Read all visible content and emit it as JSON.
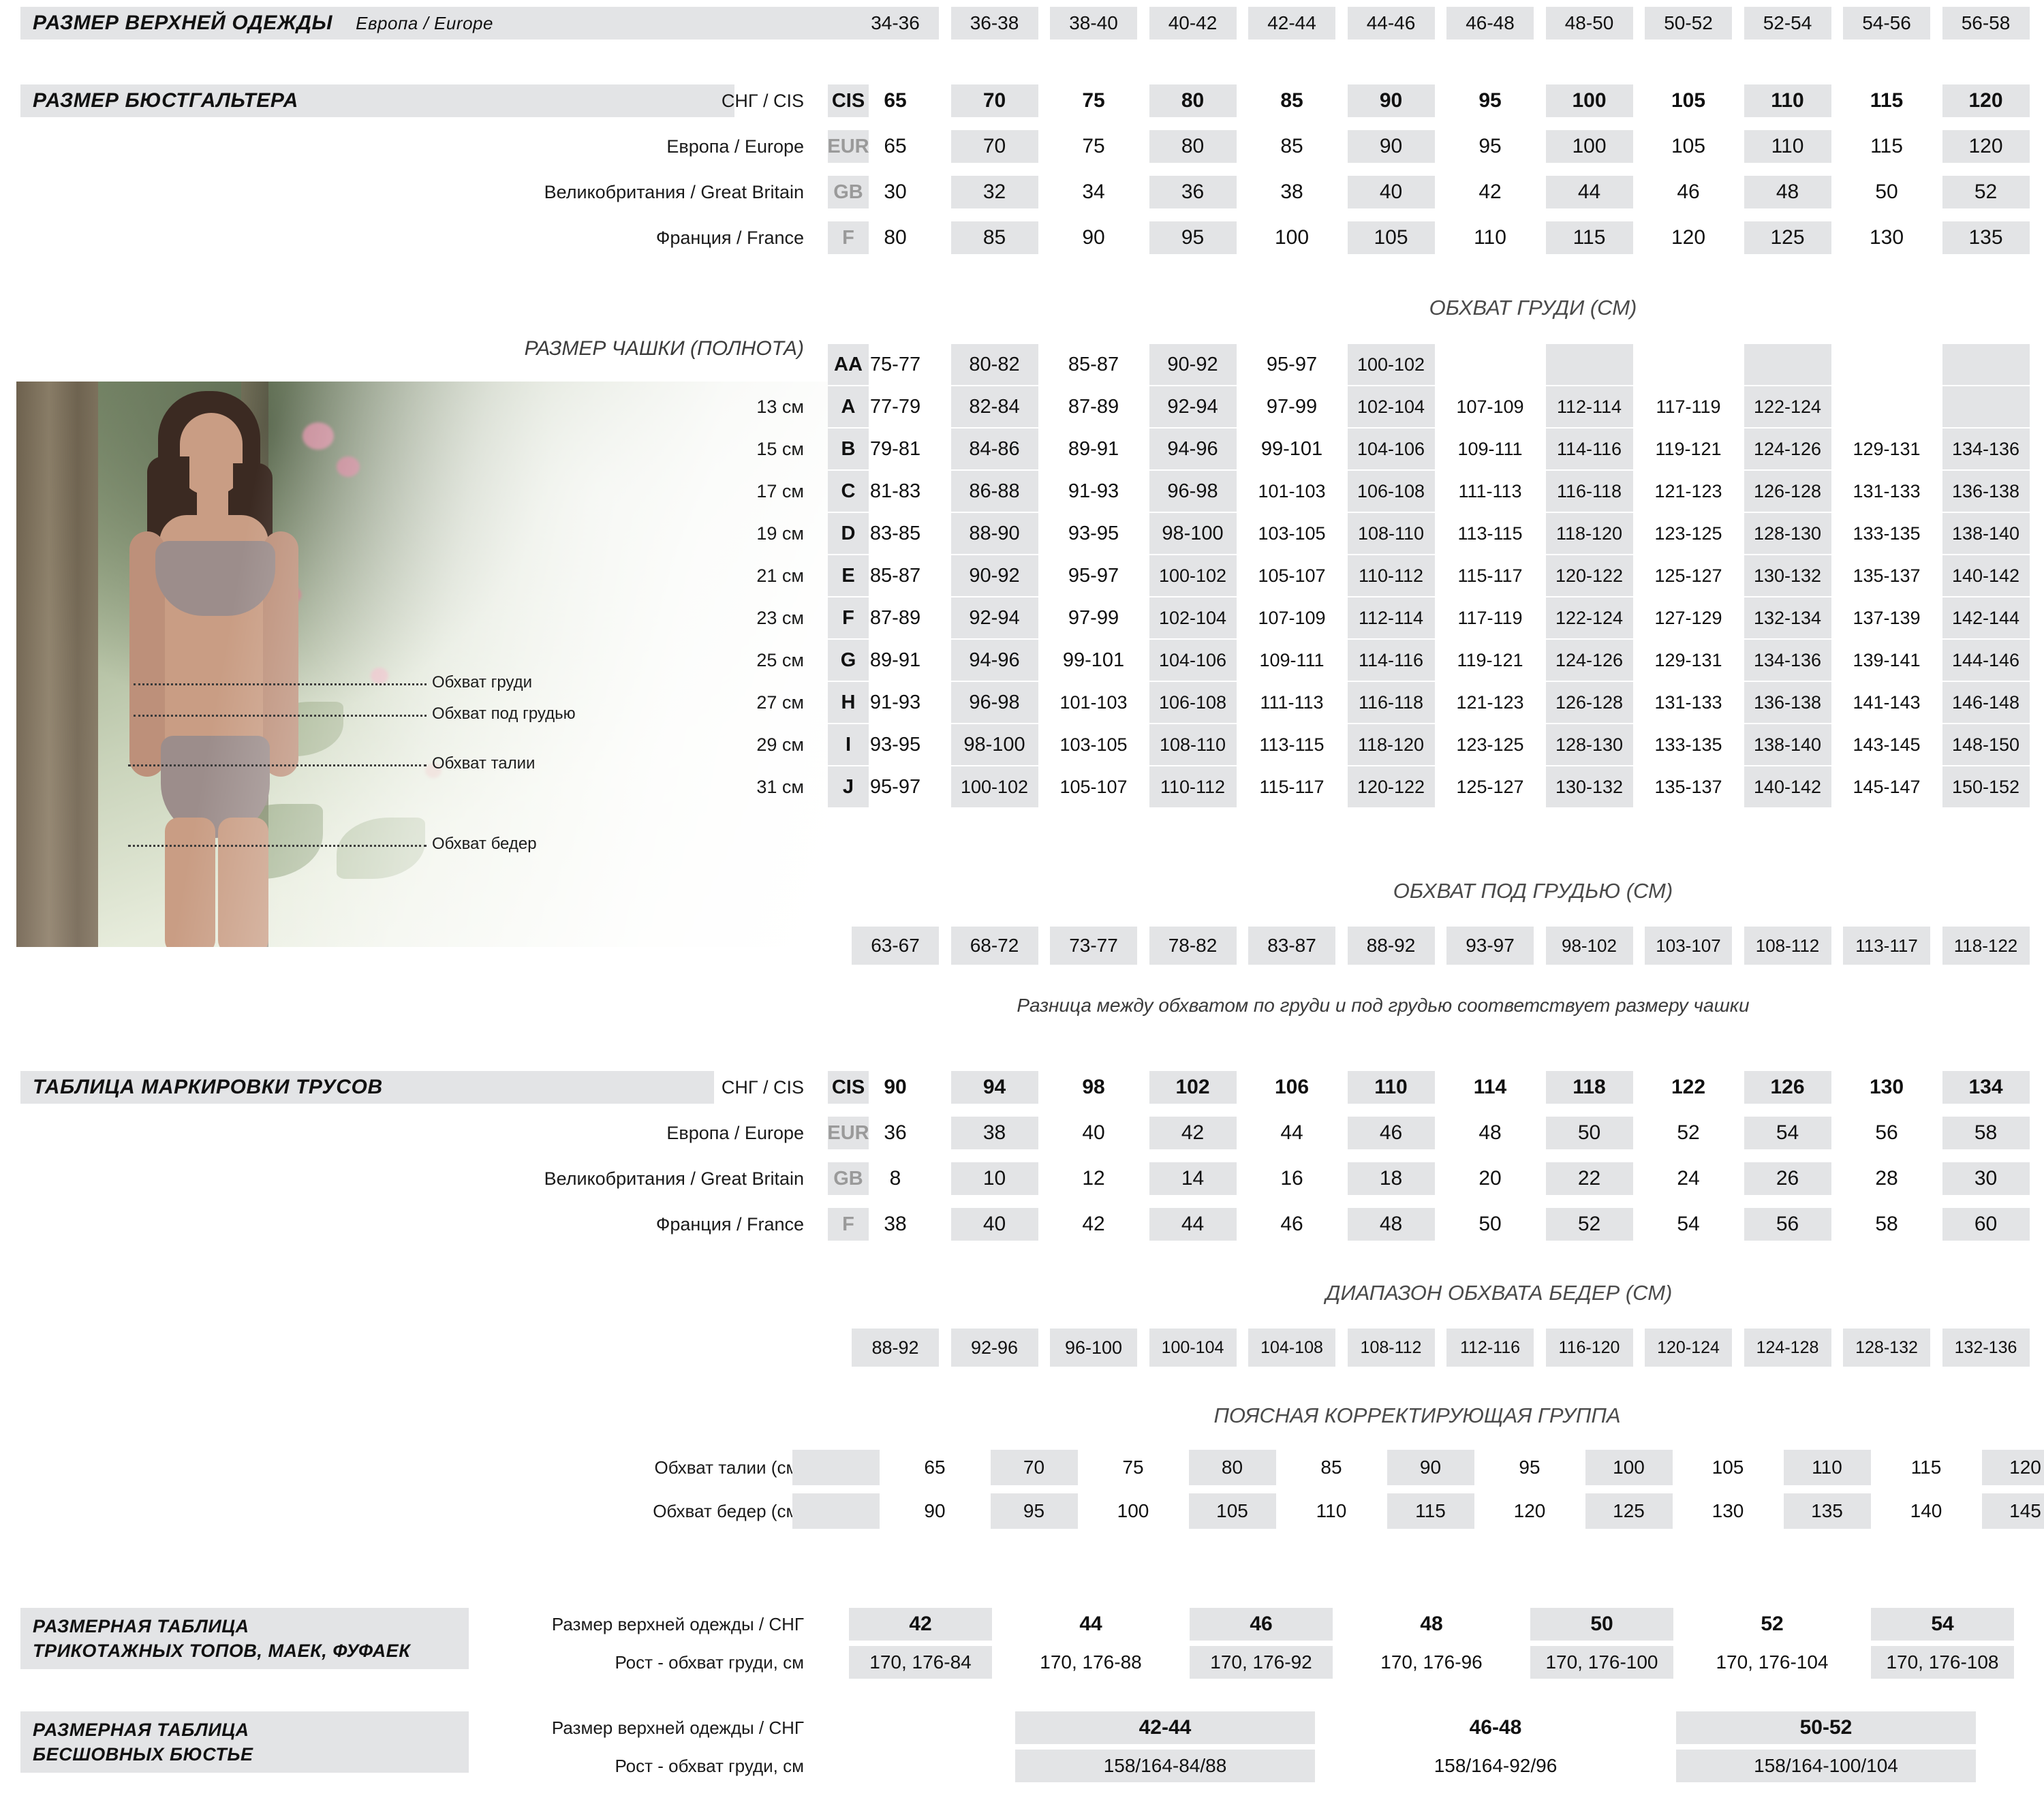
{
  "outerwear": {
    "title": "РАЗМЕР ВЕРХНЕЙ ОДЕЖДЫ",
    "subtitle": "Европа / Europe",
    "values": [
      "34-36",
      "36-38",
      "38-40",
      "40-42",
      "42-44",
      "44-46",
      "46-48",
      "48-50",
      "50-52",
      "52-54",
      "54-56",
      "56-58"
    ]
  },
  "bra": {
    "title": "РАЗМЕР БЮСТГАЛЬТЕРА",
    "rows": [
      {
        "label": "СНГ / CIS",
        "code": "CIS",
        "bold": true,
        "values": [
          "65",
          "70",
          "75",
          "80",
          "85",
          "90",
          "95",
          "100",
          "105",
          "110",
          "115",
          "120"
        ]
      },
      {
        "label": "Европа / Europe",
        "code": "EUR",
        "bold": false,
        "values": [
          "65",
          "70",
          "75",
          "80",
          "85",
          "90",
          "95",
          "100",
          "105",
          "110",
          "115",
          "120"
        ]
      },
      {
        "label": "Великобритания / Great Britain",
        "code": "GB",
        "bold": false,
        "values": [
          "30",
          "32",
          "34",
          "36",
          "38",
          "40",
          "42",
          "44",
          "46",
          "48",
          "50",
          "52"
        ]
      },
      {
        "label": "Франция / France",
        "code": "F",
        "bold": false,
        "values": [
          "80",
          "85",
          "90",
          "95",
          "100",
          "105",
          "110",
          "115",
          "120",
          "125",
          "130",
          "135"
        ]
      }
    ]
  },
  "chest": {
    "section_title": "ОБХВАТ ГРУДИ (СМ)",
    "cup_title": "РАЗМЕР ЧАШКИ (ПОЛНОТА)",
    "rows": [
      {
        "cm": "",
        "cup": "AA",
        "values": [
          "75-77",
          "80-82",
          "85-87",
          "90-92",
          "95-97",
          "100-102",
          "",
          "",
          "",
          "",
          "",
          ""
        ]
      },
      {
        "cm": "13 см",
        "cup": "A",
        "values": [
          "77-79",
          "82-84",
          "87-89",
          "92-94",
          "97-99",
          "102-104",
          "107-109",
          "112-114",
          "117-119",
          "122-124",
          "",
          ""
        ]
      },
      {
        "cm": "15 см",
        "cup": "B",
        "values": [
          "79-81",
          "84-86",
          "89-91",
          "94-96",
          "99-101",
          "104-106",
          "109-111",
          "114-116",
          "119-121",
          "124-126",
          "129-131",
          "134-136"
        ]
      },
      {
        "cm": "17 см",
        "cup": "C",
        "values": [
          "81-83",
          "86-88",
          "91-93",
          "96-98",
          "101-103",
          "106-108",
          "111-113",
          "116-118",
          "121-123",
          "126-128",
          "131-133",
          "136-138"
        ]
      },
      {
        "cm": "19 см",
        "cup": "D",
        "values": [
          "83-85",
          "88-90",
          "93-95",
          "98-100",
          "103-105",
          "108-110",
          "113-115",
          "118-120",
          "123-125",
          "128-130",
          "133-135",
          "138-140"
        ]
      },
      {
        "cm": "21 см",
        "cup": "E",
        "values": [
          "85-87",
          "90-92",
          "95-97",
          "100-102",
          "105-107",
          "110-112",
          "115-117",
          "120-122",
          "125-127",
          "130-132",
          "135-137",
          "140-142"
        ]
      },
      {
        "cm": "23 см",
        "cup": "F",
        "values": [
          "87-89",
          "92-94",
          "97-99",
          "102-104",
          "107-109",
          "112-114",
          "117-119",
          "122-124",
          "127-129",
          "132-134",
          "137-139",
          "142-144"
        ]
      },
      {
        "cm": "25 см",
        "cup": "G",
        "values": [
          "89-91",
          "94-96",
          "99-101",
          "104-106",
          "109-111",
          "114-116",
          "119-121",
          "124-126",
          "129-131",
          "134-136",
          "139-141",
          "144-146"
        ]
      },
      {
        "cm": "27 см",
        "cup": "H",
        "values": [
          "91-93",
          "96-98",
          "101-103",
          "106-108",
          "111-113",
          "116-118",
          "121-123",
          "126-128",
          "131-133",
          "136-138",
          "141-143",
          "146-148"
        ]
      },
      {
        "cm": "29 см",
        "cup": "I",
        "values": [
          "93-95",
          "98-100",
          "103-105",
          "108-110",
          "113-115",
          "118-120",
          "123-125",
          "128-130",
          "133-135",
          "138-140",
          "143-145",
          "148-150"
        ]
      },
      {
        "cm": "31 см",
        "cup": "J",
        "values": [
          "95-97",
          "100-102",
          "105-107",
          "110-112",
          "115-117",
          "120-122",
          "125-127",
          "130-132",
          "135-137",
          "140-142",
          "145-147",
          "150-152"
        ]
      }
    ]
  },
  "underbust": {
    "section_title": "ОБХВАТ ПОД ГРУДЬЮ (СМ)",
    "values": [
      "63-67",
      "68-72",
      "73-77",
      "78-82",
      "83-87",
      "88-92",
      "93-97",
      "98-102",
      "103-107",
      "108-112",
      "113-117",
      "118-122"
    ],
    "note": "Разница между обхватом по груди и под грудью соответствует размеру чашки"
  },
  "panties": {
    "title": "ТАБЛИЦА  МАРКИРОВКИ ТРУСОВ",
    "rows": [
      {
        "label": "СНГ / CIS",
        "code": "CIS",
        "bold": true,
        "values": [
          "90",
          "94",
          "98",
          "102",
          "106",
          "110",
          "114",
          "118",
          "122",
          "126",
          "130",
          "134"
        ]
      },
      {
        "label": "Европа / Europe",
        "code": "EUR",
        "bold": false,
        "values": [
          "36",
          "38",
          "40",
          "42",
          "44",
          "46",
          "48",
          "50",
          "52",
          "54",
          "56",
          "58"
        ]
      },
      {
        "label": "Великобритания / Great Britain",
        "code": "GB",
        "bold": false,
        "values": [
          "8",
          "10",
          "12",
          "14",
          "16",
          "18",
          "20",
          "22",
          "24",
          "26",
          "28",
          "30"
        ]
      },
      {
        "label": "Франция / France",
        "code": "F",
        "bold": false,
        "values": [
          "38",
          "40",
          "42",
          "44",
          "46",
          "48",
          "50",
          "52",
          "54",
          "56",
          "58",
          "60"
        ]
      }
    ]
  },
  "hips": {
    "section_title": "ДИАПАЗОН ОБХВАТА БЕДЕР (СМ)",
    "values": [
      "88-92",
      "92-96",
      "96-100",
      "100-104",
      "104-108",
      "108-112",
      "112-116",
      "116-120",
      "120-124",
      "124-128",
      "128-132",
      "132-136"
    ]
  },
  "waist_group": {
    "section_title": "ПОЯСНАЯ КОРРЕКТИРУЮЩАЯ ГРУППА",
    "rows": [
      {
        "label": "Обхват талии (см)",
        "values": [
          "",
          "65",
          "70",
          "75",
          "80",
          "85",
          "90",
          "95",
          "100",
          "105",
          "110",
          "115",
          "120"
        ]
      },
      {
        "label": "Обхват бедер (см)",
        "values": [
          "",
          "90",
          "95",
          "100",
          "105",
          "110",
          "115",
          "120",
          "125",
          "130",
          "135",
          "140",
          "145"
        ]
      }
    ]
  },
  "tops": {
    "title_line1": "РАЗМЕРНАЯ  ТАБЛИЦА",
    "title_line2": "ТРИКОТАЖНЫХ ТОПОВ, МАЕК, ФУФАЕК",
    "rows": [
      {
        "label": "Размер верхней одежды / СНГ",
        "values": [
          "42",
          "44",
          "46",
          "48",
          "50",
          "52",
          "54"
        ]
      },
      {
        "label": "Рост -  обхват груди, см",
        "values": [
          "170, 176-84",
          "170, 176-88",
          "170, 176-92",
          "170, 176-96",
          "170, 176-100",
          "170, 176-104",
          "170, 176-108"
        ]
      }
    ]
  },
  "bustier": {
    "title_line1": "РАЗМЕРНАЯ  ТАБЛИЦА",
    "title_line2": "БЕСШОВНЫХ  БЮСТЬЕ",
    "rows": [
      {
        "label": "Размер верхней одежды / СНГ",
        "values": [
          "42-44",
          "46-48",
          "50-52"
        ]
      },
      {
        "label": "Рост -  обхват груди, см",
        "values": [
          "158/164-84/88",
          "158/164-92/96",
          "158/164-100/104"
        ]
      }
    ]
  },
  "photo_callouts": [
    {
      "text": "Обхват груди"
    },
    {
      "text": "Обхват под грудью"
    },
    {
      "text": "Обхват талии"
    },
    {
      "text": "Обхват бедер"
    }
  ],
  "colors": {
    "shade": "#e3e4e6",
    "text": "#111111",
    "muted": "#9a9a9a"
  }
}
